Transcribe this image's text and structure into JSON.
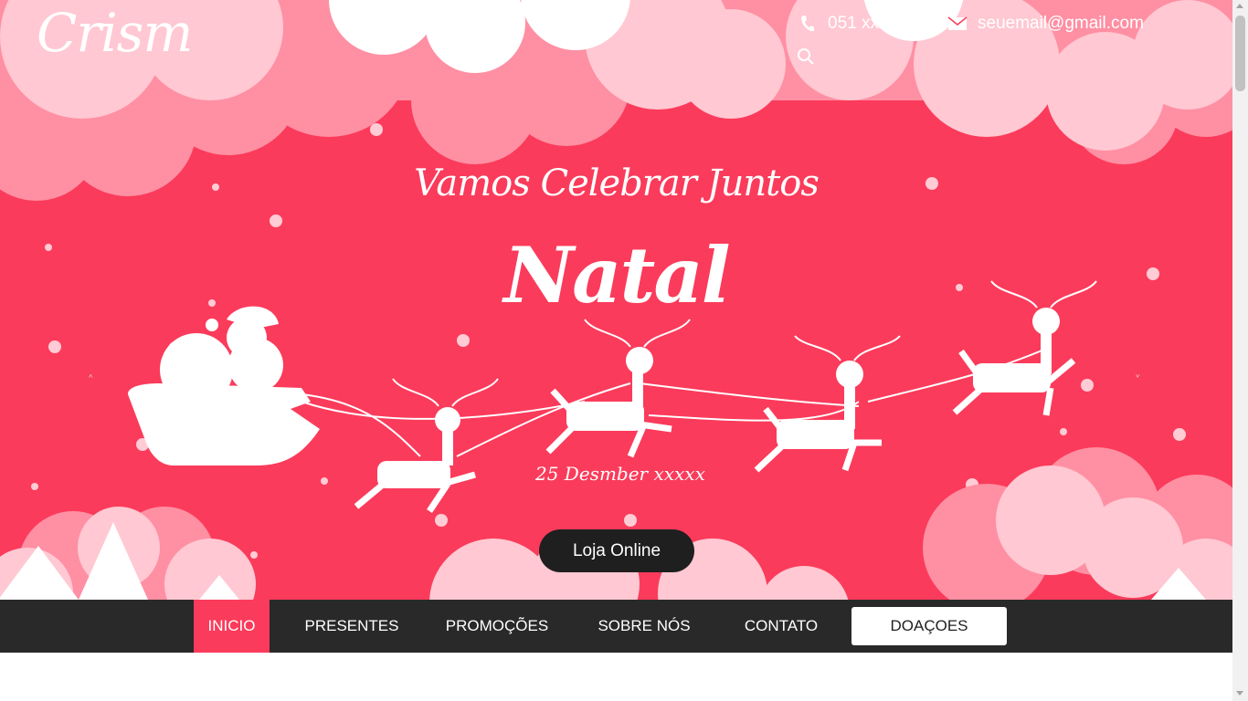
{
  "brand": {
    "logo_text": "Crism"
  },
  "header": {
    "phone": "051 xxxxxxxx",
    "email": "seuemail@gmail.com",
    "icons": {
      "phone": "phone-icon",
      "email": "mail-icon",
      "search": "search-icon"
    }
  },
  "hero": {
    "subtitle": "Vamos Celebrar Juntos",
    "title": "Natal",
    "date": "25 Desmber xxxxx",
    "cta_label": "Loja Online",
    "prev_icon": "˄",
    "next_icon": "˅",
    "colors": {
      "background": "#fb3b5b",
      "cloud_light": "#ffc8d2",
      "cloud_mid": "#ff8fa3",
      "cta": "#1f1f1f"
    }
  },
  "nav": {
    "items": [
      {
        "label": "INICIO",
        "active": true
      },
      {
        "label": "PRESENTES",
        "active": false
      },
      {
        "label": "PROMOÇÕES",
        "active": false
      },
      {
        "label": "SOBRE NÓS",
        "active": false
      },
      {
        "label": "CONTATO",
        "active": false
      }
    ],
    "button_label": "DOAÇOES",
    "colors": {
      "bar": "#292929",
      "active": "#fb3b5b"
    }
  }
}
